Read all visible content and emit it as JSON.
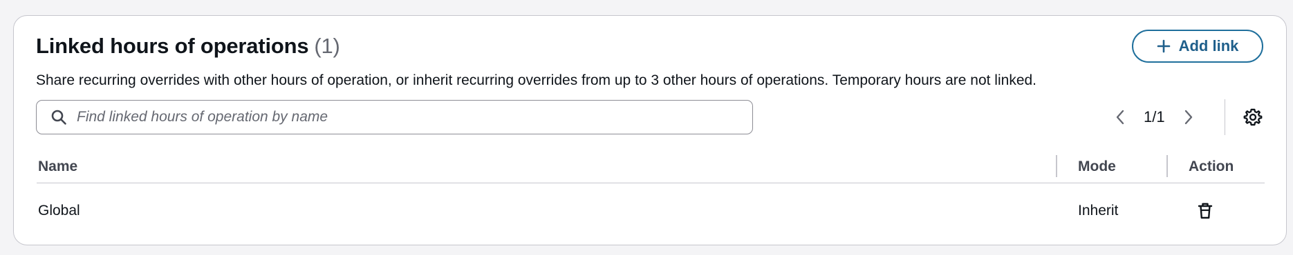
{
  "section": {
    "title": "Linked hours of operations",
    "count": "(1)",
    "description": "Share recurring overrides with other hours of operation, or inherit recurring overrides from up to 3 other hours of operations. Temporary hours are not linked.",
    "add_button_label": "Add link"
  },
  "search": {
    "placeholder": "Find linked hours of operation by name",
    "value": ""
  },
  "pagination": {
    "label": "1/1",
    "current_page": 1,
    "total_pages": 1
  },
  "table": {
    "columns": [
      "Name",
      "Mode",
      "Action"
    ],
    "rows": [
      {
        "name": "Global",
        "mode": "Inherit",
        "action_icon": "delete-icon"
      }
    ]
  },
  "colors": {
    "accent": "#1f5f8b",
    "border": "#c6c6cd",
    "text": "#0f141a",
    "muted": "#656871"
  }
}
